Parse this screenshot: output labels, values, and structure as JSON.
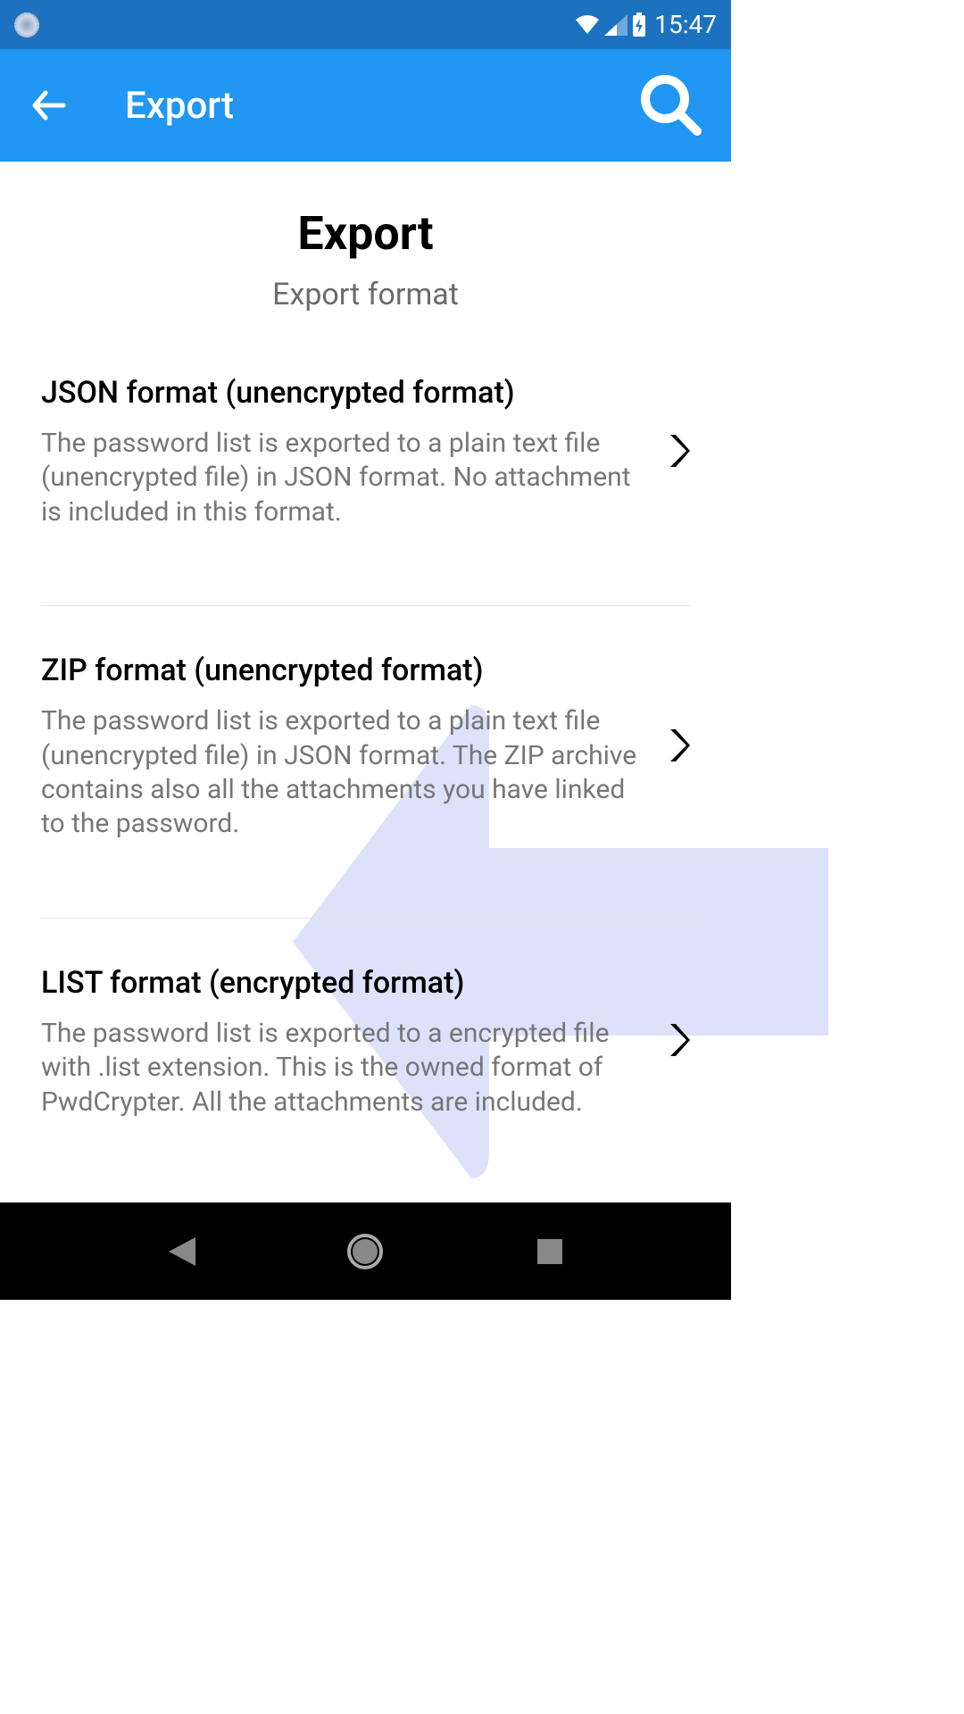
{
  "status": {
    "time": "15:47"
  },
  "header": {
    "title": "Export"
  },
  "page": {
    "title": "Export",
    "subtitle": "Export format"
  },
  "options": [
    {
      "title": "JSON format (unencrypted format)",
      "description": "The password list is exported to a plain text file (unencrypted file) in JSON format. No attachment is included in this format."
    },
    {
      "title": "ZIP format (unencrypted format)",
      "description": "The password list is exported to a plain text file (unencrypted file) in JSON format. The ZIP archive contains also all the attachments you have linked to the password."
    },
    {
      "title": "LIST format (encrypted format)",
      "description": "The password list is exported to a encrypted file with .list extension. This is the owned format of PwdCrypter. All the attachments are included."
    }
  ]
}
